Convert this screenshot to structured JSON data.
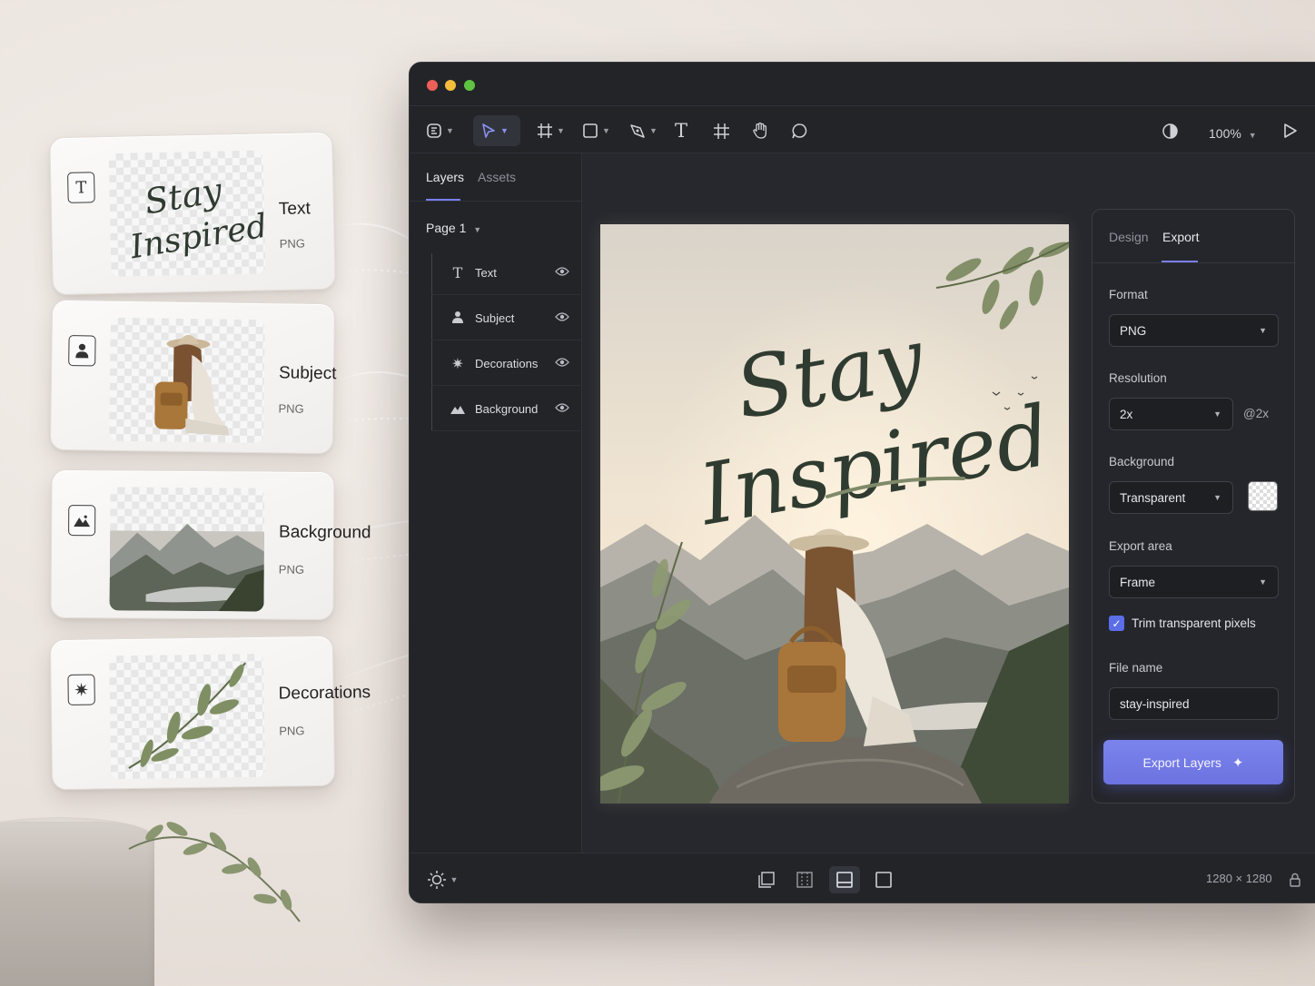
{
  "layer_cards": [
    {
      "name": "Text",
      "type": "PNG",
      "icon": "text-icon"
    },
    {
      "name": "Subject",
      "type": "PNG",
      "icon": "person-icon"
    },
    {
      "name": "Background",
      "type": "PNG",
      "icon": "mountain-icon"
    },
    {
      "name": "Decorations",
      "type": "PNG",
      "icon": "sparkle-icon"
    }
  ],
  "toolbar": {
    "zoom": "100%",
    "tools": [
      "logo-icon",
      "move-tool-icon",
      "frame-tool-icon",
      "rectangle-tool-icon",
      "pen-tool-icon",
      "text-tool-icon",
      "grid-tool-icon",
      "hand-tool-icon",
      "comment-tool-icon",
      "contrast-icon",
      "play-icon"
    ]
  },
  "sidebar": {
    "tabs": [
      "Layers",
      "Assets"
    ],
    "page": "Page 1",
    "layers": [
      {
        "name": "Text",
        "icon": "text-icon"
      },
      {
        "name": "Subject",
        "icon": "person-icon"
      },
      {
        "name": "Decorations",
        "icon": "sparkle-icon"
      },
      {
        "name": "Background",
        "icon": "mountain-icon"
      }
    ]
  },
  "artboard": {
    "headline_line1": "Stay",
    "headline_line2": "Inspired"
  },
  "export_panel": {
    "tabs": [
      "Design",
      "Export"
    ],
    "format_label": "Format",
    "format_value": "PNG",
    "resolution_label": "Resolution",
    "resolution_value": "2x",
    "resolution_suffix": "@2x",
    "background_label": "Background",
    "background_value": "Transparent",
    "export_area_label": "Export area",
    "export_area_value": "Frame",
    "trim_label": "Trim transparent pixels",
    "trim_checked": true,
    "file_name_label": "File name",
    "file_name_value": "stay-inspired",
    "export_button": "Export Layers"
  },
  "bottombar": {
    "dimensions": "1280 × 1280"
  },
  "colors": {
    "accent": "#6c73e0",
    "window_bg": "#222428",
    "panel_bg": "#24262b",
    "traffic_red": "#ed5f57",
    "traffic_yellow": "#f4bd3c",
    "traffic_green": "#5fc341"
  }
}
